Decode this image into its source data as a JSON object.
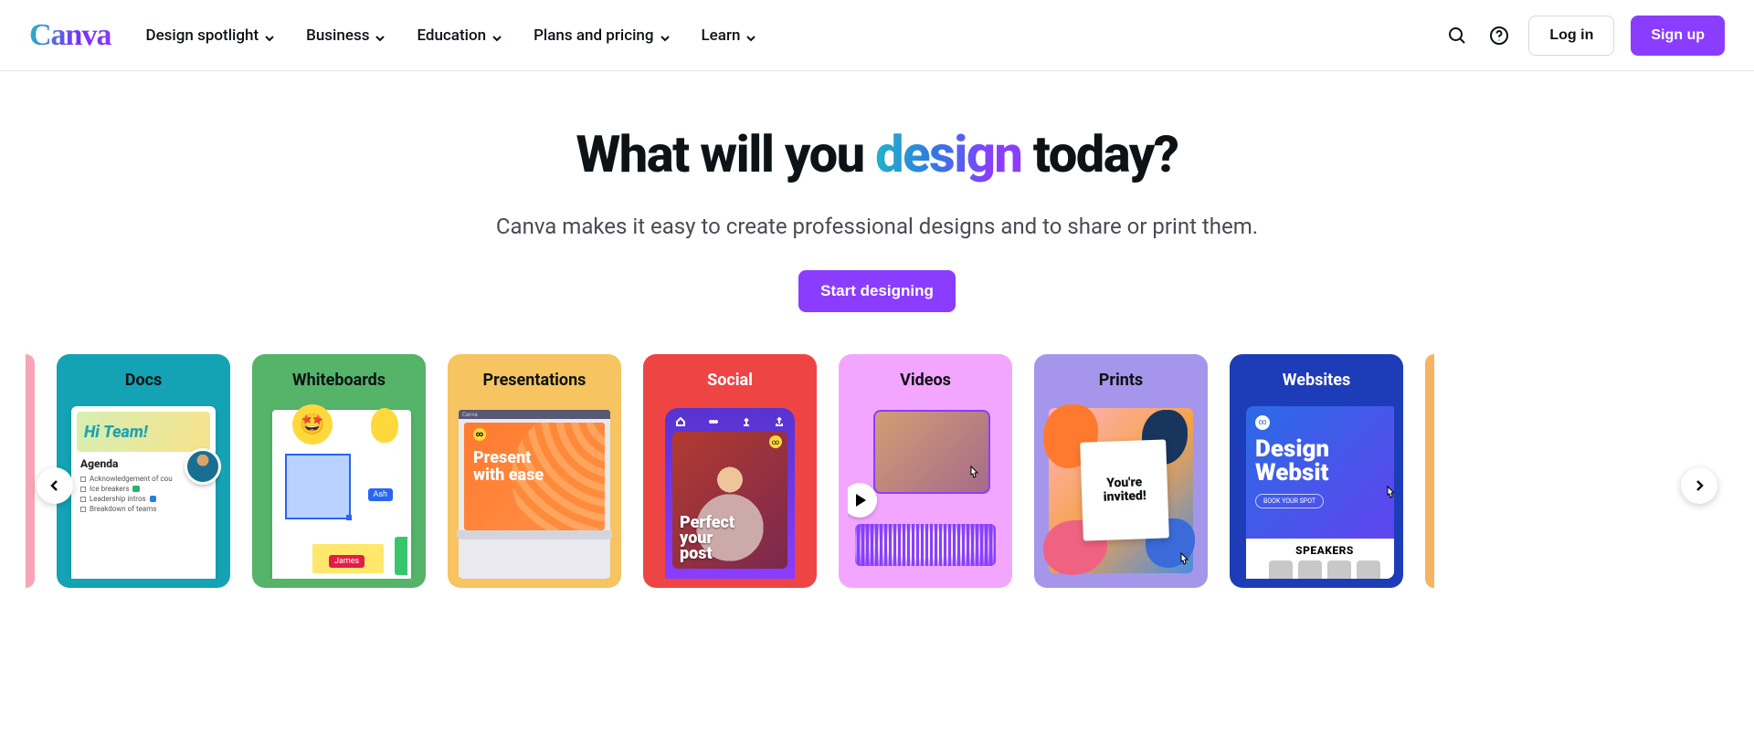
{
  "header": {
    "logo_text": "Canva",
    "nav": [
      {
        "label": "Design spotlight"
      },
      {
        "label": "Business"
      },
      {
        "label": "Education"
      },
      {
        "label": "Plans and pricing"
      },
      {
        "label": "Learn"
      }
    ],
    "login_label": "Log in",
    "signup_label": "Sign up"
  },
  "hero": {
    "title_pre": "What will you ",
    "title_grad": "design",
    "title_post": " today?",
    "subtitle": "Canva makes it easy to create professional designs and to share or print them.",
    "cta_label": "Start designing"
  },
  "cards": {
    "docs": {
      "title": "Docs",
      "preview": {
        "headline": "Hi Team!",
        "agenda_label": "Agenda",
        "items": [
          "Acknowledgement of cou",
          "Ice breakers",
          "Leadership intros",
          "Breakdown of teams"
        ]
      }
    },
    "whiteboards": {
      "title": "Whiteboards",
      "preview": {
        "tag1": "Ash",
        "tag2": "James"
      }
    },
    "presentations": {
      "title": "Presentations",
      "preview": {
        "app": "Canva",
        "line1": "Present",
        "line2": "with ease"
      }
    },
    "social": {
      "title": "Social",
      "preview": {
        "line1": "Perfect",
        "line2": "your",
        "line3": "post"
      }
    },
    "videos": {
      "title": "Videos"
    },
    "prints": {
      "title": "Prints",
      "preview": {
        "line1": "You're",
        "line2": "invited!"
      }
    },
    "websites": {
      "title": "Websites",
      "preview": {
        "h1a": "Design",
        "h1b": "Websit",
        "pill": "BOOK YOUR SPOT",
        "speakers": "SPEAKERS"
      }
    }
  }
}
